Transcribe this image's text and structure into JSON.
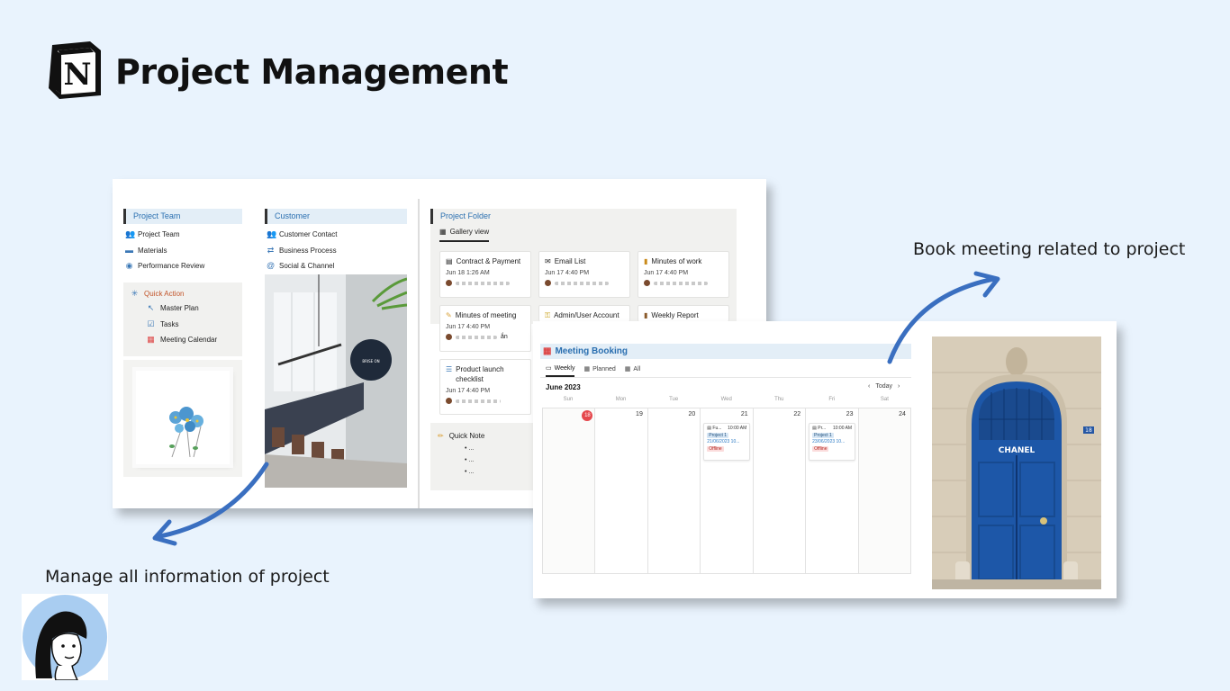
{
  "header": {
    "title": "Project Management"
  },
  "captions": {
    "left": "Manage all information of project",
    "right": "Book meeting related to project"
  },
  "project_team": {
    "heading": "Project Team",
    "items": [
      {
        "label": "Project Team",
        "icon": "people-icon"
      },
      {
        "label": "Materials",
        "icon": "folder-icon"
      },
      {
        "label": "Performance Review",
        "icon": "review-icon"
      }
    ]
  },
  "quick_action": {
    "heading": "Quick Action",
    "items": [
      {
        "label": "Master Plan",
        "icon": "arrow-icon"
      },
      {
        "label": "Tasks",
        "icon": "checkbox-icon"
      },
      {
        "label": "Meeting Calendar",
        "icon": "calendar-icon"
      }
    ]
  },
  "customer": {
    "heading": "Customer",
    "items": [
      {
        "label": "Customer Contact",
        "icon": "people-icon"
      },
      {
        "label": "Business Process",
        "icon": "sync-icon"
      },
      {
        "label": "Social & Channel",
        "icon": "at-icon"
      }
    ]
  },
  "project_folder": {
    "heading": "Project Folder",
    "view": "Gallery view",
    "cards": [
      {
        "title": "Contract & Payment",
        "date": "Jun 18 1:26 AM",
        "icon": "document-icon"
      },
      {
        "title": "Email List",
        "date": "Jun 17 4:40 PM",
        "icon": "email-icon"
      },
      {
        "title": "Minutes of work",
        "date": "Jun 17 4:40 PM",
        "icon": "note-icon"
      },
      {
        "title": "Minutes of meeting",
        "date": "Jun 17 4:40 PM",
        "icon": "memo-icon",
        "suffix": "ắn"
      },
      {
        "title": "Admin/User Account",
        "date": "",
        "icon": "key-icon"
      },
      {
        "title": "Weekly Report",
        "date": "",
        "icon": "book-icon"
      },
      {
        "title": "Product launch checklist",
        "date": "Jun 17 4:40 PM",
        "icon": "checklist-icon"
      }
    ]
  },
  "quick_note": {
    "heading": "Quick Note",
    "items": [
      "...",
      "...",
      "..."
    ]
  },
  "meeting_booking": {
    "heading": "Meeting Booking",
    "tabs": [
      "Weekly",
      "Planned",
      "All"
    ],
    "month": "June 2023",
    "today_label": "Today",
    "days_of_week": [
      "Sun",
      "Mon",
      "Tue",
      "Wed",
      "Thu",
      "Fri",
      "Sat"
    ],
    "dates": [
      "18",
      "19",
      "20",
      "21",
      "22",
      "23",
      "24"
    ],
    "events": [
      {
        "day_index": 3,
        "title": "Fu...",
        "time": "10:00 AM",
        "project": "Project 1",
        "date": "21/06/2023 10...",
        "tag": "Offline"
      },
      {
        "day_index": 5,
        "title": "Pr...",
        "time": "10:00 AM",
        "project": "Project 1",
        "date": "23/06/2023 10...",
        "tag": "Offline"
      }
    ]
  },
  "chanel_sign": {
    "text": "CHANEL",
    "number": "18"
  },
  "office_sign": {
    "text": "BRISE ON"
  },
  "colors": {
    "background": "#e9f3fd",
    "arrow": "#3a6fc0",
    "heading_blue": "#2a6fb0",
    "today_red": "#e5484d"
  }
}
